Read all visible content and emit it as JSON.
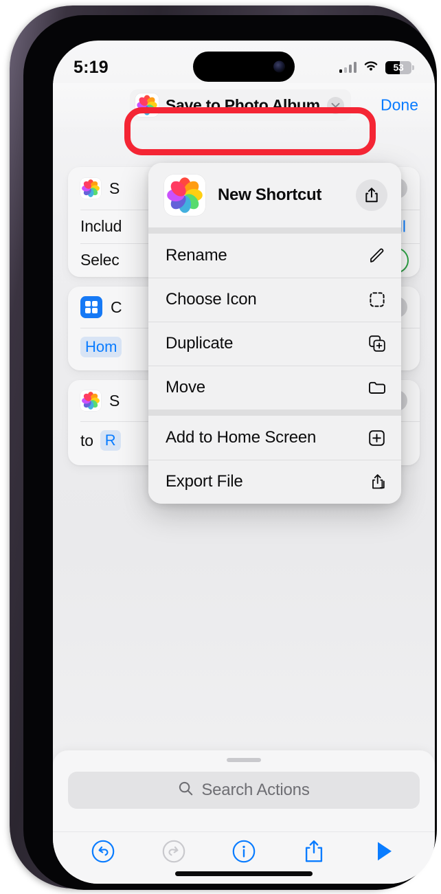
{
  "status_bar": {
    "time": "5:19",
    "signal_icon": "cellular-bars-icon",
    "wifi_icon": "wifi-icon",
    "battery_percent": "53",
    "battery_fill_ratio": 0.54
  },
  "nav": {
    "app_icon": "photos-app-icon",
    "title": "Save to Photo Album",
    "chevron_icon": "chevron-down-icon",
    "done_label": "Done"
  },
  "annotation": {
    "type": "highlight-ring",
    "color": "#f42534",
    "target": "shortcut-title-pill"
  },
  "context_menu": {
    "header": {
      "icon": "photos-app-icon",
      "title": "New Shortcut",
      "share_icon": "share-icon"
    },
    "groups": [
      {
        "items": [
          {
            "label": "Rename",
            "icon": "pencil-icon"
          },
          {
            "label": "Choose Icon",
            "icon": "dashed-square-icon"
          },
          {
            "label": "Duplicate",
            "icon": "duplicate-icon"
          },
          {
            "label": "Move",
            "icon": "folder-icon"
          }
        ]
      },
      {
        "items": [
          {
            "label": "Add to Home Screen",
            "icon": "plus-square-icon"
          },
          {
            "label": "Export File",
            "icon": "export-icon"
          }
        ]
      }
    ]
  },
  "action_cards": [
    {
      "icon": "photos-app-icon",
      "rows": [
        {
          "text": "S",
          "trailing": "delete-button"
        },
        {
          "text": "Includ",
          "trailing": "all-link",
          "trailing_label": "All"
        },
        {
          "text": "Selec",
          "trailing": "toggle-on"
        }
      ]
    },
    {
      "icon": "shortcuts-grid-icon",
      "rows": [
        {
          "text": "C",
          "trailing": "delete-button"
        },
        {
          "token": "Hom"
        }
      ]
    },
    {
      "icon": "photos-app-icon",
      "rows": [
        {
          "text": "S",
          "trailing": "delete-button"
        },
        {
          "text": "to",
          "token": "R"
        }
      ]
    }
  ],
  "bottom_sheet": {
    "grabber": "sheet-grabber",
    "search": {
      "placeholder": "Search Actions",
      "icon": "search-icon"
    },
    "toolbar": [
      {
        "name": "undo-button",
        "icon": "undo-icon",
        "color": "#0a7cff",
        "enabled": true
      },
      {
        "name": "redo-button",
        "icon": "redo-icon",
        "color": "#c2c2c6",
        "enabled": false
      },
      {
        "name": "info-button",
        "icon": "info-icon",
        "color": "#0a7cff",
        "enabled": true
      },
      {
        "name": "share-button",
        "icon": "share-icon",
        "color": "#0a7cff",
        "enabled": true
      },
      {
        "name": "play-button",
        "icon": "play-icon",
        "color": "#0a7cff",
        "enabled": true
      }
    ]
  },
  "colors": {
    "accent_blue": "#0a7cff",
    "toggle_green": "#30b14a",
    "annotation_red": "#f42534",
    "screen_bg": "#ececee"
  }
}
